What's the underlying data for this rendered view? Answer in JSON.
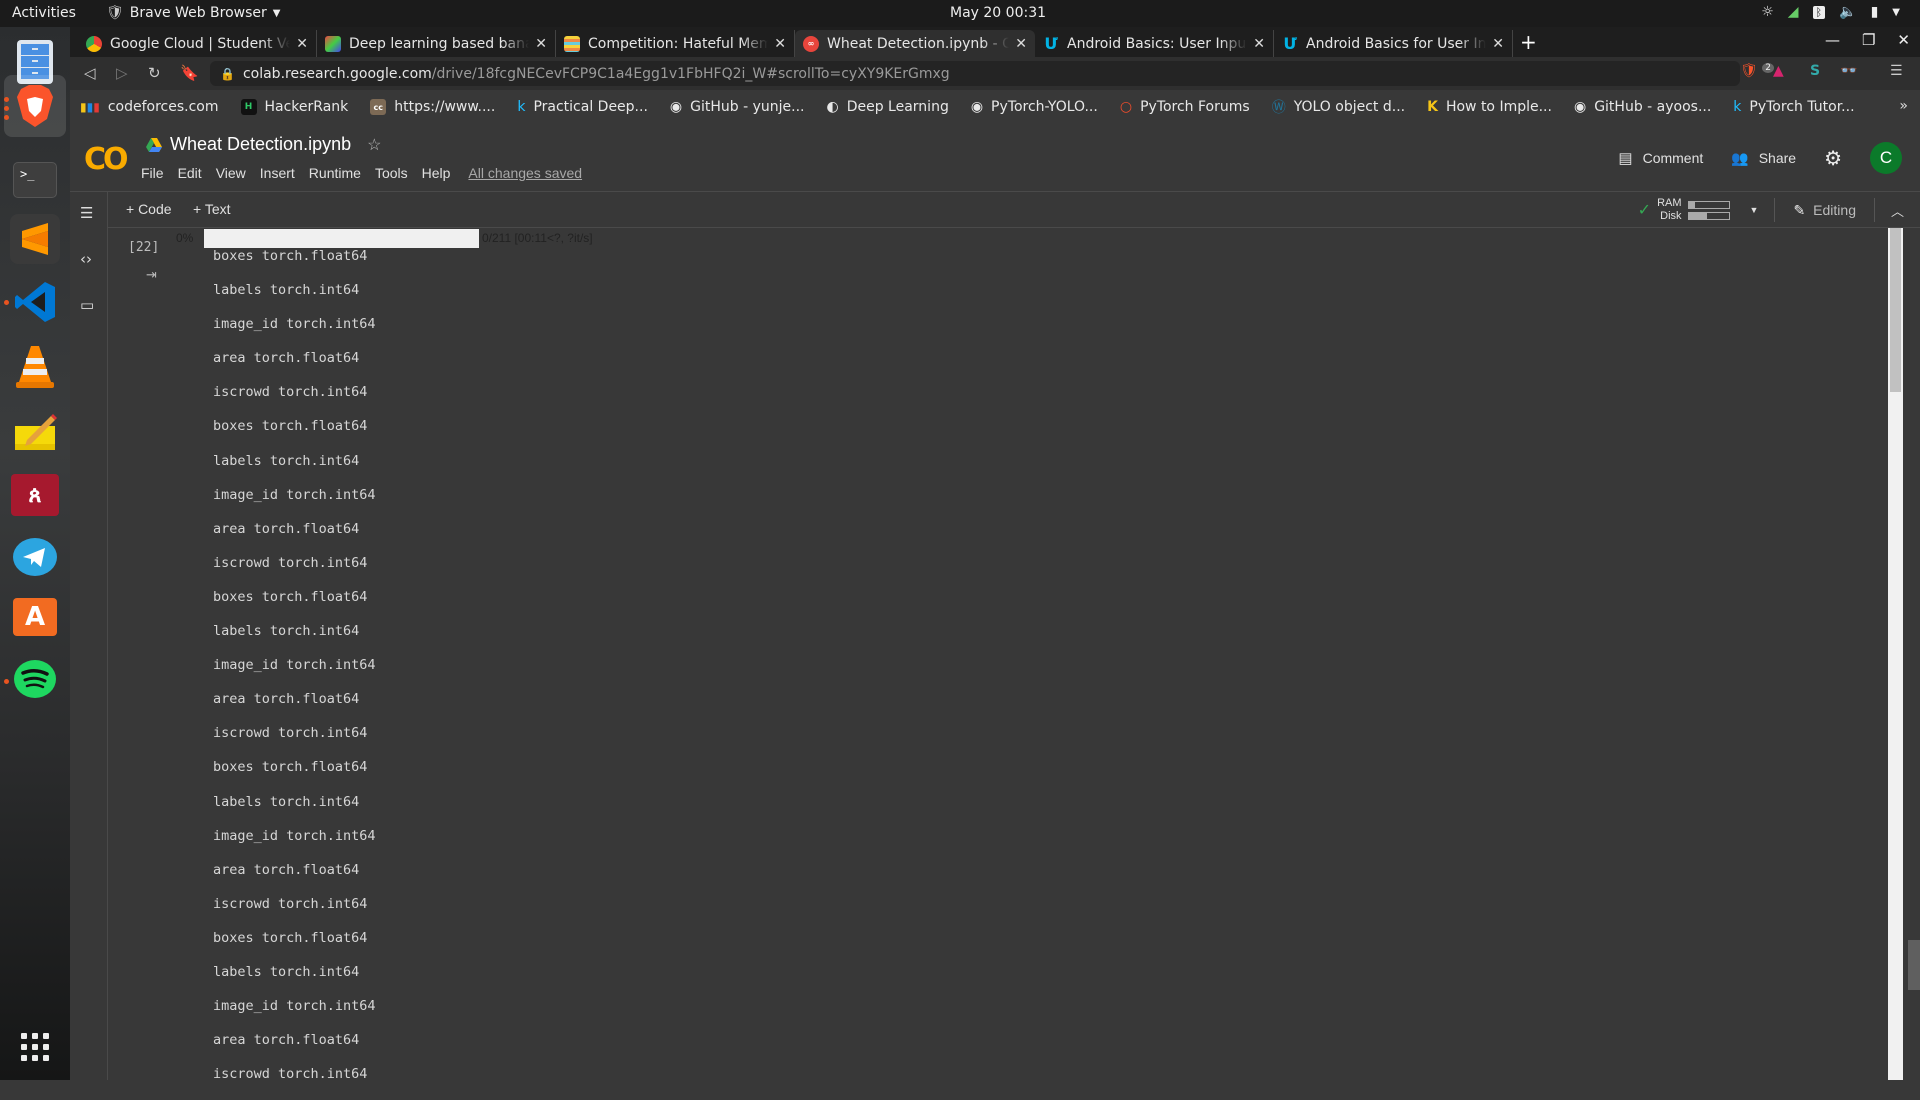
{
  "system_bar": {
    "activities": "Activities",
    "app_menu": "Brave Web Browser",
    "clock": "May 20  00:31",
    "tray_icons": [
      "brightness-icon",
      "signal-icon",
      "bluetooth-icon",
      "volume-icon",
      "battery-icon",
      "dropdown-icon"
    ]
  },
  "dock": {
    "items": [
      {
        "name": "files",
        "icon": "file-cabinet-icon",
        "running": false
      },
      {
        "name": "brave",
        "icon": "brave-lion-icon",
        "running": true,
        "active": true
      },
      {
        "name": "terminal",
        "icon": "terminal-icon",
        "running": false
      },
      {
        "name": "sublime-text",
        "icon": "sublime-icon",
        "running": false
      },
      {
        "name": "vscode",
        "icon": "vscode-icon",
        "running": true
      },
      {
        "name": "vlc",
        "icon": "vlc-cone-icon",
        "running": false
      },
      {
        "name": "text-editor",
        "icon": "notepad-icon",
        "running": false
      },
      {
        "name": "mendeley",
        "icon": "mendeley-icon",
        "running": false
      },
      {
        "name": "telegram",
        "icon": "telegram-icon",
        "running": false
      },
      {
        "name": "software-center",
        "icon": "app-store-icon",
        "running": false
      },
      {
        "name": "spotify",
        "icon": "spotify-icon",
        "running": true
      }
    ],
    "show_apps": "grid-icon"
  },
  "browser": {
    "tabs": [
      {
        "title": "Google Cloud | Student Ver",
        "favicon": "google-cloud-icon",
        "active": false
      },
      {
        "title": "Deep learning based banan",
        "favicon": "colorful-icon",
        "active": false
      },
      {
        "title": "Competition: Hateful Mem",
        "favicon": "drivendata-icon",
        "active": false
      },
      {
        "title": "Wheat Detection.ipynb - Co",
        "favicon": "colab-icon",
        "active": true
      },
      {
        "title": "Android Basics: User Input",
        "favicon": "udacity-icon",
        "active": false
      },
      {
        "title": "Android Basics for User Int",
        "favicon": "udacity-icon",
        "active": false
      }
    ],
    "new_tab": "+",
    "url_host": "colab.research.google.com",
    "url_path": "/drive/18fcgNECevFCP9C1a4Egg1v1FbHFQ2i_W#scrollTo=cyXY9KErGmxg",
    "shield_count": "2",
    "bookmarks": [
      {
        "label": "codeforces.com",
        "icon": "codeforces-icon"
      },
      {
        "label": "HackerRank",
        "icon": "hackerrank-icon"
      },
      {
        "label": "https://www....",
        "icon": "cc-icon"
      },
      {
        "label": "Practical Deep...",
        "icon": "kaggle-k-icon"
      },
      {
        "label": "GitHub - yunje...",
        "icon": "github-icon"
      },
      {
        "label": "Deep Learning",
        "icon": "globe-icon"
      },
      {
        "label": "PyTorch-YOLO...",
        "icon": "github-icon"
      },
      {
        "label": "PyTorch Forums",
        "icon": "pytorch-icon"
      },
      {
        "label": "YOLO object d...",
        "icon": "wordpress-icon"
      },
      {
        "label": "How to Imple...",
        "icon": "k-yellow-icon"
      },
      {
        "label": "GitHub - ayoos...",
        "icon": "github-icon"
      },
      {
        "label": "PyTorch Tutor...",
        "icon": "kaggle-k-icon"
      }
    ],
    "bookmarks_more": "»"
  },
  "colab": {
    "logo": "CO",
    "notebook_title": "Wheat Detection.ipynb",
    "menu": [
      "File",
      "Edit",
      "View",
      "Insert",
      "Runtime",
      "Tools",
      "Help"
    ],
    "save_status": "All changes saved",
    "comment_label": "Comment",
    "share_label": "Share",
    "avatar_letter": "C",
    "add_code": "+ Code",
    "add_text": "+ Text",
    "ram_label": "RAM",
    "disk_label": "Disk",
    "ram_usage": 0.15,
    "disk_usage": 0.45,
    "editing_label": "Editing",
    "cell": {
      "execution_count": "[22]",
      "progress": {
        "percent_label": "0%",
        "fraction": 0.0,
        "status": "0/211 [00:11<?, ?it/s]"
      },
      "output_lines": [
        "boxes torch.float64",
        "labels torch.int64",
        "image_id torch.int64",
        "area torch.float64",
        "iscrowd torch.int64",
        "boxes torch.float64",
        "labels torch.int64",
        "image_id torch.int64",
        "area torch.float64",
        "iscrowd torch.int64",
        "boxes torch.float64",
        "labels torch.int64",
        "image_id torch.int64",
        "area torch.float64",
        "iscrowd torch.int64",
        "boxes torch.float64",
        "labels torch.int64",
        "image_id torch.int64",
        "area torch.float64",
        "iscrowd torch.int64",
        "boxes torch.float64",
        "labels torch.int64",
        "image_id torch.int64",
        "area torch.float64",
        "iscrowd torch.int64"
      ]
    }
  },
  "colors": {
    "colab_orange": "#f9ab00",
    "avatar_green": "#0b7a2a",
    "ubuntu_orange": "#e95420",
    "check_green": "#34a853"
  }
}
